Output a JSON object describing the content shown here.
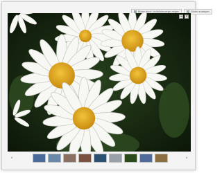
{
  "toolbar": {
    "btn1_label": "Bilder durch Vollbildanzeige zeigen",
    "btn2_label": "Bilder anzeigen"
  },
  "controls": {
    "prev_glyph": "‹",
    "next_glyph": "›",
    "expand_glyph": "+",
    "close_glyph": "×"
  },
  "thumbnails": [
    {
      "name": "thumb-1",
      "color": "#4a6a9a"
    },
    {
      "name": "thumb-2",
      "color": "#6a88a8"
    },
    {
      "name": "thumb-3",
      "color": "#8a7060"
    },
    {
      "name": "thumb-4",
      "color": "#7a5040"
    },
    {
      "name": "thumb-5",
      "color": "#2a5070"
    },
    {
      "name": "thumb-6",
      "color": "#9aa0a8"
    },
    {
      "name": "thumb-7",
      "color": "#2b4a1a"
    },
    {
      "name": "thumb-8",
      "color": "#506a9a"
    },
    {
      "name": "thumb-9",
      "color": "#8a7040"
    }
  ]
}
